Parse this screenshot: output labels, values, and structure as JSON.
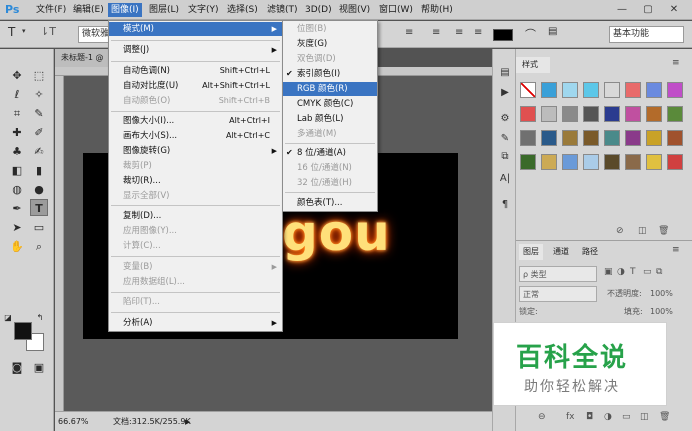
{
  "menubar": {
    "logo": "Ps",
    "items": [
      "文件(F)",
      "编辑(E)",
      "图像(I)",
      "图层(L)",
      "文字(Y)",
      "选择(S)",
      "滤镜(T)",
      "3D(D)",
      "视图(V)",
      "窗口(W)",
      "帮助(H)"
    ],
    "window_buttons": [
      "—",
      "▢",
      "✕"
    ]
  },
  "options": {
    "tool_glyph": "T",
    "font_name": "微软雅",
    "workspace": "基本功能"
  },
  "document": {
    "tab_title": "未标题-1 @",
    "canvas_text": "gou",
    "zoom": "66.67%",
    "doc_info": "文档:312.5K/255.9K"
  },
  "image_menu": {
    "items": [
      {
        "label": "模式(M)",
        "shortcut": "",
        "arrow": true,
        "disabled": false,
        "highlight": true
      },
      {
        "label": "调整(J)",
        "shortcut": "",
        "arrow": true,
        "disabled": false
      },
      {
        "label": "自动色调(N)",
        "shortcut": "Shift+Ctrl+L",
        "disabled": false
      },
      {
        "label": "自动对比度(U)",
        "shortcut": "Alt+Shift+Ctrl+L",
        "disabled": false
      },
      {
        "label": "自动颜色(O)",
        "shortcut": "Shift+Ctrl+B",
        "disabled": true
      },
      {
        "label": "图像大小(I)...",
        "shortcut": "Alt+Ctrl+I",
        "disabled": false
      },
      {
        "label": "画布大小(S)...",
        "shortcut": "Alt+Ctrl+C",
        "disabled": false
      },
      {
        "label": "图像旋转(G)",
        "shortcut": "",
        "arrow": true,
        "disabled": false
      },
      {
        "label": "裁剪(P)",
        "shortcut": "",
        "disabled": true
      },
      {
        "label": "裁切(R)...",
        "shortcut": "",
        "disabled": false
      },
      {
        "label": "显示全部(V)",
        "shortcut": "",
        "disabled": true
      },
      {
        "label": "复制(D)...",
        "shortcut": "",
        "disabled": false
      },
      {
        "label": "应用图像(Y)...",
        "shortcut": "",
        "disabled": true
      },
      {
        "label": "计算(C)...",
        "shortcut": "",
        "disabled": true
      },
      {
        "label": "变量(B)",
        "shortcut": "",
        "arrow": true,
        "disabled": true
      },
      {
        "label": "应用数据组(L)...",
        "shortcut": "",
        "disabled": true
      },
      {
        "label": "陷印(T)...",
        "shortcut": "",
        "disabled": true
      },
      {
        "label": "分析(A)",
        "shortcut": "",
        "arrow": true,
        "disabled": false
      }
    ]
  },
  "mode_menu": {
    "items": [
      {
        "label": "位图(B)",
        "disabled": true
      },
      {
        "label": "灰度(G)",
        "disabled": false
      },
      {
        "label": "双色调(D)",
        "disabled": true
      },
      {
        "label": "索引颜色(I)",
        "disabled": false,
        "checked": true
      },
      {
        "label": "RGB 颜色(R)",
        "disabled": false,
        "highlight": true
      },
      {
        "label": "CMYK 颜色(C)",
        "disabled": false
      },
      {
        "label": "Lab 颜色(L)",
        "disabled": false
      },
      {
        "label": "多通道(M)",
        "disabled": true
      },
      {
        "label": "8 位/通道(A)",
        "disabled": false,
        "checked": true
      },
      {
        "label": "16 位/通道(N)",
        "disabled": true
      },
      {
        "label": "32 位/通道(H)",
        "disabled": true
      },
      {
        "label": "颜色表(T)...",
        "disabled": false
      }
    ]
  },
  "styles_panel": {
    "tab": "样式"
  },
  "layers_panel": {
    "tabs": [
      "图层",
      "通道",
      "路径"
    ],
    "filter": "ρ 类型",
    "blend": "正常",
    "opacity_label": "不透明度:",
    "opacity_value": "100%",
    "lock_label": "锁定:",
    "fill_label": "填充:",
    "fill_value": "100%"
  },
  "watermark": {
    "title": "百科全说",
    "subtitle": "助你轻松解决"
  }
}
